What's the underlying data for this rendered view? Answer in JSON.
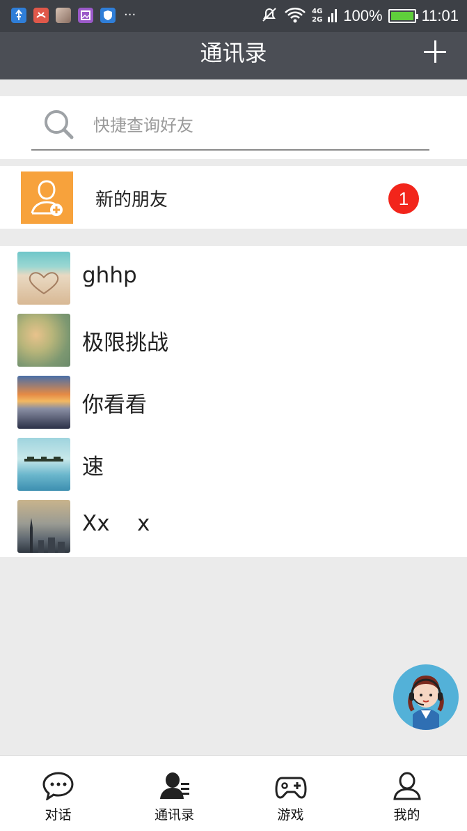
{
  "status_bar": {
    "app_icons": [
      {
        "name": "usb-icon",
        "color": "#2f7ed8"
      },
      {
        "name": "missed-call-icon",
        "color": "#e0584a"
      },
      {
        "name": "photo-notification-icon",
        "color": "#b99a88"
      },
      {
        "name": "gallery-icon",
        "color": "#9b59c9"
      },
      {
        "name": "shield-icon",
        "color": "#2f7ed8"
      }
    ],
    "more": "···",
    "network_top": "4G",
    "network_bottom": "2G",
    "battery": "100%",
    "battery_level": 1.0,
    "time": "11:01"
  },
  "header": {
    "title": "通讯录",
    "add_icon": "plus-icon"
  },
  "search": {
    "placeholder": "快捷查询好友",
    "value": ""
  },
  "new_friend": {
    "label": "新的朋友",
    "badge": "1",
    "icon": "add-user-icon",
    "icon_color": "#f7a23c"
  },
  "contacts": [
    {
      "name": "ghhp",
      "avatar": "beach-heart-avatar"
    },
    {
      "name": "极限挑战",
      "avatar": "blossom-avatar"
    },
    {
      "name": "你看看",
      "avatar": "sunrise-avatar"
    },
    {
      "name": "速",
      "avatar": "sky-avatar"
    },
    {
      "name": "Xx    x",
      "avatar": "city-avatar"
    }
  ],
  "service_button": {
    "icon": "customer-service-icon",
    "color": "#53b1d8"
  },
  "bottom_nav": {
    "items": [
      {
        "label": "对话",
        "icon": "chat-bubble-icon"
      },
      {
        "label": "通讯录",
        "icon": "contacts-icon",
        "active": true
      },
      {
        "label": "游戏",
        "icon": "gamepad-icon"
      },
      {
        "label": "我的",
        "icon": "profile-icon"
      }
    ]
  },
  "colors": {
    "header_bg": "#4b4e55",
    "badge": "#f2251b",
    "page_bg": "#ebebeb"
  }
}
